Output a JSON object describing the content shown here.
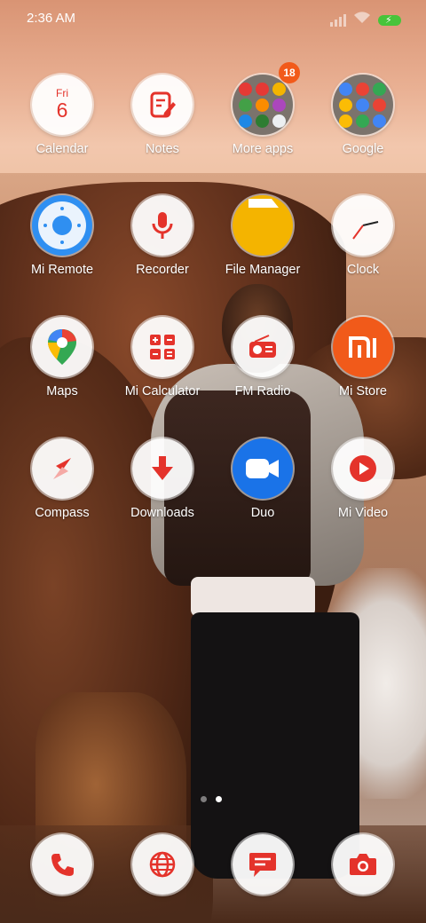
{
  "status_bar": {
    "time": "2:36 AM",
    "battery_color": "#47c43a",
    "icons": [
      "signal-icon",
      "wifi-icon",
      "battery-charging-icon"
    ]
  },
  "apps": [
    {
      "label": "Calendar",
      "icon": "calendar-icon",
      "day": "Fri",
      "date": "6"
    },
    {
      "label": "Notes",
      "icon": "notes-icon"
    },
    {
      "label": "More apps",
      "icon": "folder-icon",
      "badge": "18"
    },
    {
      "label": "Google",
      "icon": "folder-icon"
    },
    {
      "label": "Mi Remote",
      "icon": "remote-icon"
    },
    {
      "label": "Recorder",
      "icon": "microphone-icon"
    },
    {
      "label": "File Manager",
      "icon": "folder-file-icon"
    },
    {
      "label": "Clock",
      "icon": "clock-icon"
    },
    {
      "label": "Maps",
      "icon": "map-pin-icon"
    },
    {
      "label": "Mi Calculator",
      "icon": "calculator-icon"
    },
    {
      "label": "FM Radio",
      "icon": "radio-icon"
    },
    {
      "label": "Mi Store",
      "icon": "mi-logo-icon"
    },
    {
      "label": "Compass",
      "icon": "compass-icon"
    },
    {
      "label": "Downloads",
      "icon": "download-arrow-icon"
    },
    {
      "label": "Duo",
      "icon": "video-camera-icon"
    },
    {
      "label": "Mi Video",
      "icon": "play-icon"
    }
  ],
  "pager": {
    "pages": 2,
    "current": 2
  },
  "dock": [
    {
      "icon": "phone-icon"
    },
    {
      "icon": "globe-icon"
    },
    {
      "icon": "message-icon"
    },
    {
      "icon": "camera-icon"
    }
  ],
  "colors": {
    "accent_red": "#e4332b",
    "badge": "#f25a1a",
    "mi_orange": "#f15a1a",
    "duo_blue": "#1a73e8",
    "file_manager_yellow": "#f4b400"
  }
}
